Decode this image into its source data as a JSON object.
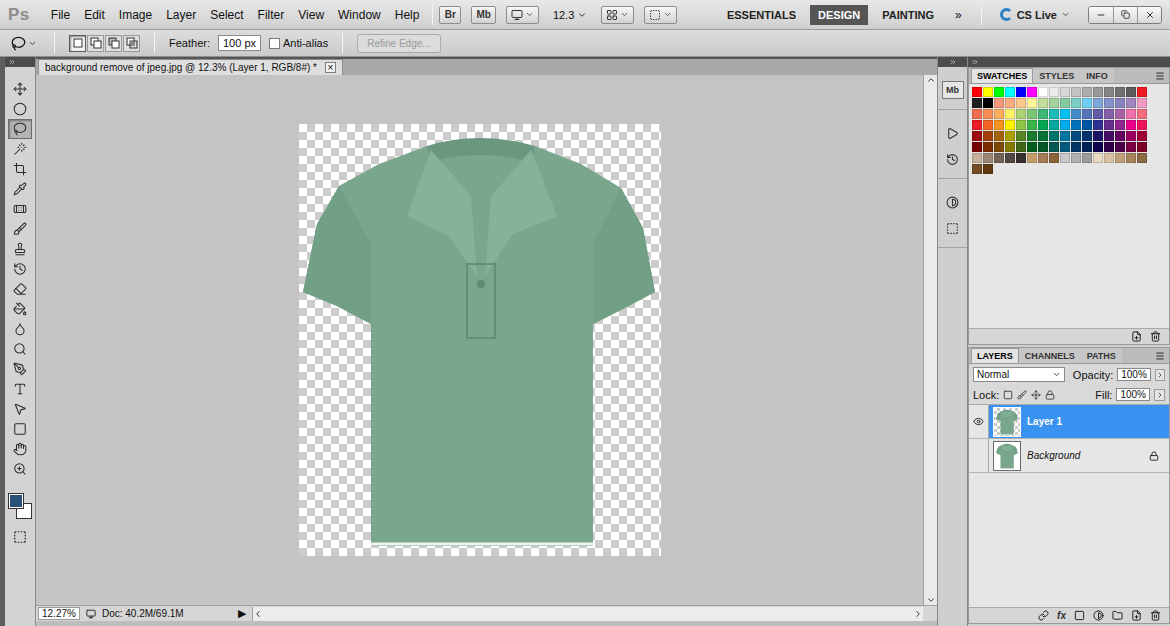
{
  "app": {
    "logo": "Ps",
    "bridge": "Br",
    "mini_bridge": "Mb",
    "zoom": "12.3",
    "cs_live": "CS Live",
    "more": "»"
  },
  "menu": [
    "File",
    "Edit",
    "Image",
    "Layer",
    "Select",
    "Filter",
    "View",
    "Window",
    "Help"
  ],
  "workspaces": [
    {
      "label": "ESSENTIALS",
      "selected": false
    },
    {
      "label": "DESIGN",
      "selected": true
    },
    {
      "label": "PAINTING",
      "selected": false
    }
  ],
  "options": {
    "feather_label": "Feather:",
    "feather_value": "100 px",
    "anti_alias": {
      "label": "Anti-alias",
      "checked": false
    },
    "refine_edge": {
      "label": "Refine Edge...",
      "disabled": true
    },
    "selection_modes": [
      {
        "selected": true
      },
      {
        "selected": false
      },
      {
        "selected": false
      },
      {
        "selected": false
      }
    ]
  },
  "tools": [
    {
      "selected": false
    },
    {
      "selected": false
    },
    {
      "selected": true
    },
    {
      "selected": false
    },
    {
      "selected": false
    },
    {
      "selected": false
    },
    {
      "selected": false
    },
    {
      "selected": false
    },
    {
      "selected": false
    },
    {
      "selected": false
    },
    {
      "selected": false
    },
    {
      "selected": false
    },
    {
      "selected": false
    },
    {
      "selected": false
    },
    {
      "selected": false
    },
    {
      "selected": false
    },
    {
      "selected": false
    },
    {
      "selected": false
    },
    {
      "selected": false
    },
    {
      "selected": false
    }
  ],
  "color_chips": {
    "foreground": "#2c5177",
    "background": "#ffffff"
  },
  "document": {
    "title": "background remove of jpeg.jpg @ 12.3% (Layer 1, RGB/8#) *",
    "close": "×"
  },
  "status_bar": {
    "zoom": "12.27%",
    "doc": "Doc: 40.2M/69.1M",
    "arrow": "▶"
  },
  "dock": {
    "mini_bridge": "Mb"
  },
  "swatches_panel": {
    "tabs": [
      {
        "label": "SWATCHES",
        "selected": true
      },
      {
        "label": "STYLES",
        "selected": false
      },
      {
        "label": "INFO",
        "selected": false
      }
    ],
    "swatches": [
      {
        "color": "#ff0000"
      },
      {
        "color": "#ffff00"
      },
      {
        "color": "#00ff00"
      },
      {
        "color": "#00ffff"
      },
      {
        "color": "#0000ff"
      },
      {
        "color": "#ff00ff"
      },
      {
        "color": "#ffffff"
      },
      {
        "color": "#ebebeb"
      },
      {
        "color": "#d6d6d6"
      },
      {
        "color": "#c2c2c2"
      },
      {
        "color": "#adadad"
      },
      {
        "color": "#999999"
      },
      {
        "color": "#858585"
      },
      {
        "color": "#707070"
      },
      {
        "color": "#5c5c5c"
      },
      {
        "color": "#ed1c24"
      },
      {
        "color": "#1f1f1f"
      },
      {
        "color": "#000000"
      },
      {
        "color": "#f7977a"
      },
      {
        "color": "#f9ad81"
      },
      {
        "color": "#fdc68a"
      },
      {
        "color": "#fff79a"
      },
      {
        "color": "#c4df9b"
      },
      {
        "color": "#a3d39c"
      },
      {
        "color": "#82ca9d"
      },
      {
        "color": "#7bcdc8"
      },
      {
        "color": "#6ecff6"
      },
      {
        "color": "#7ea7d8"
      },
      {
        "color": "#8493ca"
      },
      {
        "color": "#8882be"
      },
      {
        "color": "#a187be"
      },
      {
        "color": "#f49ac2"
      },
      {
        "color": "#f26c4f"
      },
      {
        "color": "#f68e55"
      },
      {
        "color": "#fbaf5c"
      },
      {
        "color": "#fff467"
      },
      {
        "color": "#acd372"
      },
      {
        "color": "#7cc576"
      },
      {
        "color": "#3bb878"
      },
      {
        "color": "#1abbb4"
      },
      {
        "color": "#00bff3"
      },
      {
        "color": "#438cca"
      },
      {
        "color": "#5574b9"
      },
      {
        "color": "#605ca8"
      },
      {
        "color": "#855fa8"
      },
      {
        "color": "#a763a8"
      },
      {
        "color": "#f06ea9"
      },
      {
        "color": "#f26d7d"
      },
      {
        "color": "#ed1c24"
      },
      {
        "color": "#f26522"
      },
      {
        "color": "#f7941d"
      },
      {
        "color": "#fff200"
      },
      {
        "color": "#8dc73f"
      },
      {
        "color": "#39b54a"
      },
      {
        "color": "#00a651"
      },
      {
        "color": "#00a99d"
      },
      {
        "color": "#00aeef"
      },
      {
        "color": "#0072bc"
      },
      {
        "color": "#0054a6"
      },
      {
        "color": "#2e3192"
      },
      {
        "color": "#662d91"
      },
      {
        "color": "#92278f"
      },
      {
        "color": "#ec008c"
      },
      {
        "color": "#ed145b"
      },
      {
        "color": "#9e0b0f"
      },
      {
        "color": "#a0410d"
      },
      {
        "color": "#a36209"
      },
      {
        "color": "#aba000"
      },
      {
        "color": "#598527"
      },
      {
        "color": "#197b30"
      },
      {
        "color": "#007236"
      },
      {
        "color": "#00746b"
      },
      {
        "color": "#0076a3"
      },
      {
        "color": "#004a80"
      },
      {
        "color": "#003471"
      },
      {
        "color": "#1b1464"
      },
      {
        "color": "#440e62"
      },
      {
        "color": "#630460"
      },
      {
        "color": "#9e005d"
      },
      {
        "color": "#9e0039"
      },
      {
        "color": "#790000"
      },
      {
        "color": "#7b2e00"
      },
      {
        "color": "#7d4900"
      },
      {
        "color": "#827b00"
      },
      {
        "color": "#406618"
      },
      {
        "color": "#005e20"
      },
      {
        "color": "#005826"
      },
      {
        "color": "#005952"
      },
      {
        "color": "#005b7f"
      },
      {
        "color": "#003663"
      },
      {
        "color": "#002157"
      },
      {
        "color": "#0d004c"
      },
      {
        "color": "#32004b"
      },
      {
        "color": "#4b0049"
      },
      {
        "color": "#7b0046"
      },
      {
        "color": "#7a0026"
      },
      {
        "color": "#c7b299"
      },
      {
        "color": "#998675"
      },
      {
        "color": "#736357"
      },
      {
        "color": "#534741"
      },
      {
        "color": "#37302d"
      },
      {
        "color": "#c69c6d"
      },
      {
        "color": "#a67c52"
      },
      {
        "color": "#8c6239"
      },
      {
        "color": "#c8c8c8"
      },
      {
        "color": "#b0b0b0"
      },
      {
        "color": "#9c9c9c"
      },
      {
        "color": "#e8d8c4"
      },
      {
        "color": "#d9c2a4"
      },
      {
        "color": "#bfa07a"
      },
      {
        "color": "#a68458"
      },
      {
        "color": "#8a6a40"
      },
      {
        "color": "#754c24"
      },
      {
        "color": "#603913"
      }
    ]
  },
  "layers_panel": {
    "tabs": [
      {
        "label": "LAYERS",
        "selected": true
      },
      {
        "label": "CHANNELS",
        "selected": false
      },
      {
        "label": "PATHS",
        "selected": false
      }
    ],
    "blend_mode": "Normal",
    "opacity_label": "Opacity:",
    "opacity": "100%",
    "lock_label": "Lock:",
    "fill_label": "Fill:",
    "fill": "100%",
    "fx": "fx",
    "layers": [
      {
        "name": "Layer 1",
        "selected": true,
        "visible": true,
        "locked": false,
        "transparent": true
      },
      {
        "name": "Background",
        "selected": false,
        "visible": false,
        "locked": true,
        "transparent": false
      }
    ]
  }
}
